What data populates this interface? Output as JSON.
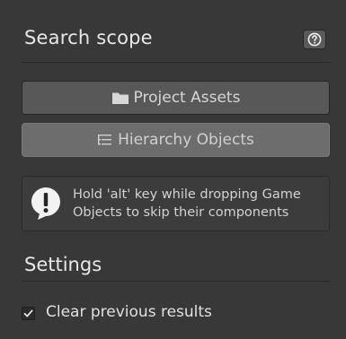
{
  "search_scope": {
    "title": "Search scope",
    "help_icon": "help-question-icon",
    "buttons": [
      {
        "label": "Project Assets",
        "icon": "folder-icon"
      },
      {
        "label": "Hierarchy Objects",
        "icon": "hierarchy-list-icon"
      }
    ],
    "info": {
      "icon": "warning-speech-icon",
      "text": "Hold 'alt' key while dropping Game\nObjects to skip their components"
    }
  },
  "settings": {
    "title": "Settings",
    "clear_previous_results": {
      "label": "Clear previous results",
      "checked": true
    }
  },
  "colors": {
    "panel_bg": "#383838",
    "button_bg": "#585858",
    "button_active_bg": "#6d6d6d",
    "text": "#e0e0e0"
  }
}
